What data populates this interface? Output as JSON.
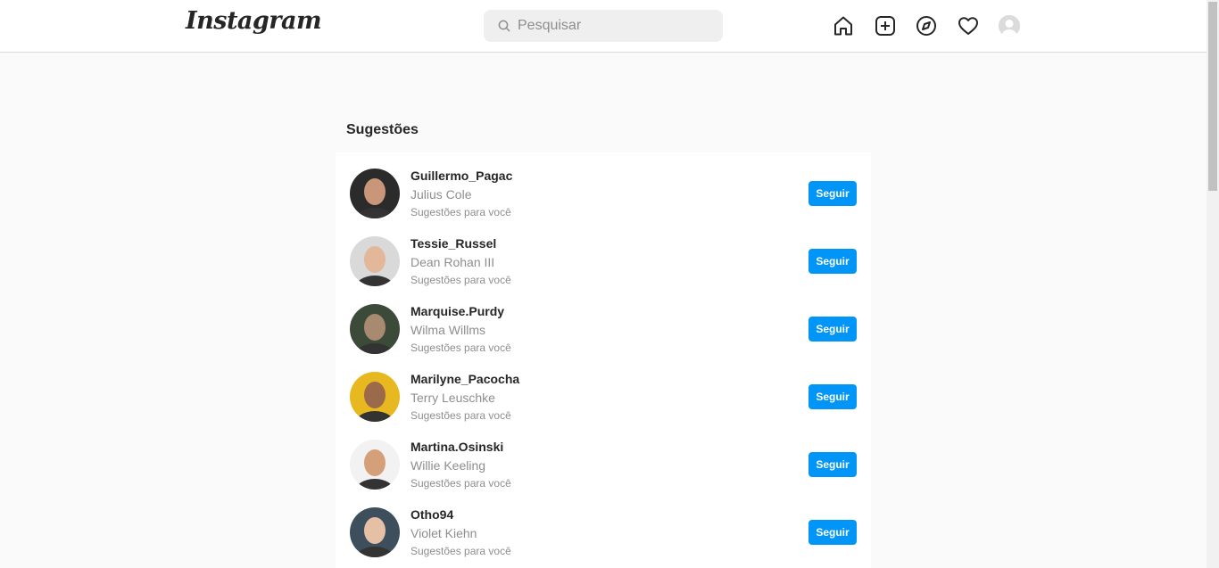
{
  "header": {
    "logo": "Instagram",
    "search": {
      "placeholder": "Pesquisar",
      "value": ""
    },
    "icons": [
      "home-icon",
      "new-post-icon",
      "explore-icon",
      "activity-heart-icon",
      "profile-avatar"
    ]
  },
  "suggestions": {
    "title": "Sugestões",
    "follow_label": "Seguir",
    "items": [
      {
        "username": "Guillermo_Pagac",
        "name": "Julius Cole",
        "subtitle": "Sugestões para você",
        "avatar_bg": "#2b2b2b",
        "avatar_face": "#c9967a"
      },
      {
        "username": "Tessie_Russel",
        "name": "Dean Rohan III",
        "subtitle": "Sugestões para você",
        "avatar_bg": "#d9d9d9",
        "avatar_face": "#e2b79a"
      },
      {
        "username": "Marquise.Purdy",
        "name": "Wilma Willms",
        "subtitle": "Sugestões para você",
        "avatar_bg": "#3c4a3a",
        "avatar_face": "#a88a70"
      },
      {
        "username": "Marilyne_Pacocha",
        "name": "Terry Leuschke",
        "subtitle": "Sugestões para você",
        "avatar_bg": "#e8b820",
        "avatar_face": "#9a6a4a"
      },
      {
        "username": "Martina.Osinski",
        "name": "Willie Keeling",
        "subtitle": "Sugestões para você",
        "avatar_bg": "#f2f2f2",
        "avatar_face": "#d4a07a"
      },
      {
        "username": "Otho94",
        "name": "Violet Kiehn",
        "subtitle": "Sugestões para você",
        "avatar_bg": "#3d4f5c",
        "avatar_face": "#e6c0a5"
      }
    ]
  },
  "colors": {
    "accent": "#0095f6",
    "background": "#fafafa",
    "text": "#262626",
    "muted": "#8e8e8e"
  }
}
